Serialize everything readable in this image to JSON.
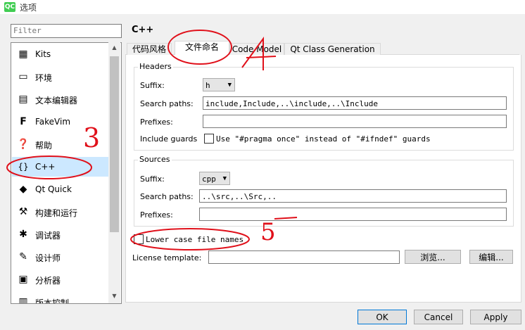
{
  "window": {
    "app_icon": "QC",
    "title": "选项"
  },
  "filter": {
    "placeholder": "Filter"
  },
  "nav": {
    "items": [
      {
        "label": "Kits",
        "icon": "kits-icon"
      },
      {
        "label": "环境",
        "icon": "monitor-icon"
      },
      {
        "label": "文本编辑器",
        "icon": "text-editor-icon"
      },
      {
        "label": "FakeVim",
        "icon": "fakevim-icon"
      },
      {
        "label": "帮助",
        "icon": "help-icon"
      },
      {
        "label": "C++",
        "icon": "braces-icon",
        "selected": true
      },
      {
        "label": "Qt Quick",
        "icon": "qtquick-icon"
      },
      {
        "label": "构建和运行",
        "icon": "hammer-icon"
      },
      {
        "label": "调试器",
        "icon": "bug-icon"
      },
      {
        "label": "设计师",
        "icon": "pencil-icon"
      },
      {
        "label": "分析器",
        "icon": "analyzer-icon"
      },
      {
        "label": "版本控制",
        "icon": "vcs-icon"
      }
    ]
  },
  "page": {
    "title": "C++",
    "tabs": [
      "代码风格",
      "文件命名",
      "Code Model",
      "Qt Class Generation"
    ],
    "active_tab": 1
  },
  "headers": {
    "title": "Headers",
    "suffix_label": "Suffix:",
    "suffix_value": "h",
    "search_label": "Search paths:",
    "search_value": "include,Include,..\\include,..\\Include",
    "prefixes_label": "Prefixes:",
    "prefixes_value": "",
    "guards_label": "Include guards",
    "guards_check_label": "Use \"#pragma once\" instead of \"#ifndef\" guards"
  },
  "sources": {
    "title": "Sources",
    "suffix_label": "Suffix:",
    "suffix_value": "cpp",
    "search_label": "Search paths:",
    "search_value": "..\\src,..\\Src,..",
    "prefixes_label": "Prefixes:",
    "prefixes_value": ""
  },
  "lowercase_label": "Lower case file names",
  "license": {
    "label": "License template:",
    "value": "",
    "browse": "浏览...",
    "edit": "编辑..."
  },
  "buttons": {
    "ok": "OK",
    "cancel": "Cancel",
    "apply": "Apply"
  },
  "annotations": {
    "n3": "3",
    "n4": "4",
    "n5": "5",
    "color": "#e0101a"
  }
}
